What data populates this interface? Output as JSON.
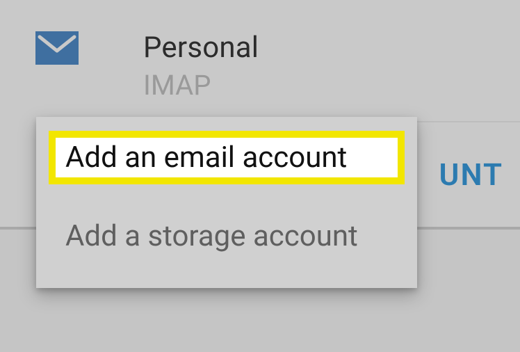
{
  "account": {
    "title": "Personal",
    "subtitle": "IMAP",
    "icon": "mail-icon"
  },
  "button": {
    "label_fragment": "UNT"
  },
  "popup": {
    "items": [
      {
        "label": "Add an email account",
        "highlighted": true
      },
      {
        "label": "Add a storage account",
        "highlighted": false
      }
    ]
  },
  "colors": {
    "accent": "#2c7bb0",
    "mail_icon": "#3f6fa0",
    "highlight": "#f2e600"
  }
}
